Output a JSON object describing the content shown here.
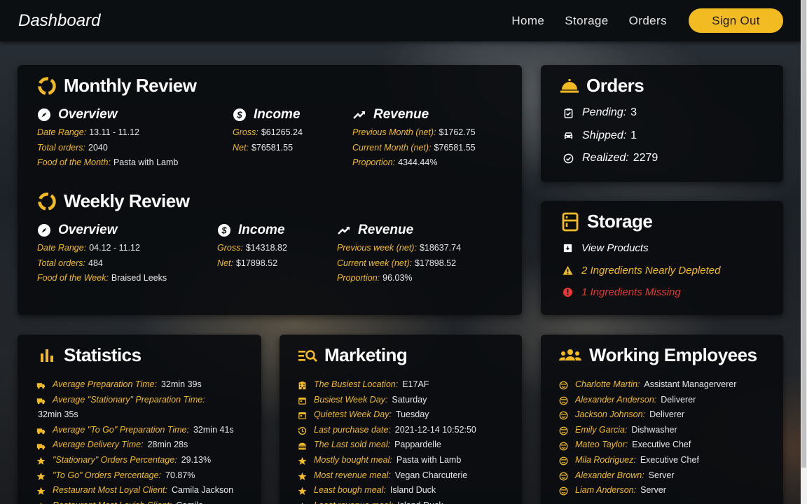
{
  "navbar": {
    "brand": "Dashboard",
    "links": [
      "Home",
      "Storage",
      "Orders"
    ],
    "signout": "Sign Out"
  },
  "colors": {
    "accent": "#f2bb21",
    "danger": "#e53935",
    "card_bg": "#0b0e11"
  },
  "monthly": {
    "title": "Monthly Review",
    "overview": {
      "title": "Overview",
      "rows": [
        {
          "k": "Date Range:",
          "v": "13.11 - 11.12"
        },
        {
          "k": "Total orders:",
          "v": "2040"
        },
        {
          "k": "Food of the Month:",
          "v": "Pasta with Lamb"
        }
      ]
    },
    "income": {
      "title": "Income",
      "rows": [
        {
          "k": "Gross:",
          "v": "$61265.24"
        },
        {
          "k": "Net:",
          "v": "$76581.55"
        }
      ]
    },
    "revenue": {
      "title": "Revenue",
      "rows": [
        {
          "k": "Previous Month (net):",
          "v": "$1762.75"
        },
        {
          "k": "Current Month (net):",
          "v": "$76581.55"
        },
        {
          "k": "Proportion:",
          "v": "4344.44%"
        }
      ]
    }
  },
  "weekly": {
    "title": "Weekly Review",
    "overview": {
      "title": "Overview",
      "rows": [
        {
          "k": "Date Range:",
          "v": "04.12 - 11.12"
        },
        {
          "k": "Total orders:",
          "v": "484"
        },
        {
          "k": "Food of the Week:",
          "v": "Braised Leeks"
        }
      ]
    },
    "income": {
      "title": "Income",
      "rows": [
        {
          "k": "Gross:",
          "v": "$14318.82"
        },
        {
          "k": "Net:",
          "v": "$17898.52"
        }
      ]
    },
    "revenue": {
      "title": "Revenue",
      "rows": [
        {
          "k": "Previous week (net):",
          "v": "$18637.74"
        },
        {
          "k": "Current week (net):",
          "v": "$17898.52"
        },
        {
          "k": "Proportion:",
          "v": "96.03%"
        }
      ]
    }
  },
  "orders": {
    "title": "Orders",
    "rows": [
      {
        "k": "Pending:",
        "v": "3"
      },
      {
        "k": "Shipped:",
        "v": "1"
      },
      {
        "k": "Realized:",
        "v": "2279"
      }
    ]
  },
  "storage": {
    "title": "Storage",
    "view_products": "View Products",
    "nearly_depleted": "2 Ingredients Nearly Depleted",
    "missing": "1 Ingredients Missing"
  },
  "statistics": {
    "title": "Statistics",
    "rows": [
      {
        "k": "Average Preparation Time:",
        "v": "32min 39s",
        "icon": "truck-icon"
      },
      {
        "k": "Average \"Stationary\" Preparation Time:",
        "v": "32min 35s",
        "icon": "truck-icon"
      },
      {
        "k": "Average \"To Go\" Preparation Time:",
        "v": "32min 41s",
        "icon": "truck-icon"
      },
      {
        "k": "Average Delivery Time:",
        "v": "28min 28s",
        "icon": "truck-icon"
      },
      {
        "k": "\"Stationary\" Orders Percentage:",
        "v": "29.13%",
        "icon": "star-icon"
      },
      {
        "k": "\"To Go\" Orders Percentage:",
        "v": "70.87%",
        "icon": "star-icon"
      },
      {
        "k": "Restaurant Most Loyal Client:",
        "v": "Camila Jackson",
        "icon": "star-icon"
      },
      {
        "k": "Restaurant Most Lavish Client:",
        "v": "Camila",
        "icon": "star-icon"
      }
    ]
  },
  "marketing": {
    "title": "Marketing",
    "rows": [
      {
        "k": "The Busiest Location:",
        "v": "E17AF",
        "icon": "building-icon"
      },
      {
        "k": "Busiest Week Day:",
        "v": "Saturday",
        "icon": "calendar-icon"
      },
      {
        "k": "Quietest Week Day:",
        "v": "Tuesday",
        "icon": "calendar-icon"
      },
      {
        "k": "Last purchase date:",
        "v": "2021-12-14 10:52:50",
        "icon": "history-icon"
      },
      {
        "k": "The Last sold meal:",
        "v": "Pappardelle",
        "icon": "burger-icon"
      },
      {
        "k": "Mostly bought meal:",
        "v": "Pasta with Lamb",
        "icon": "star-icon"
      },
      {
        "k": "Most revenue meal:",
        "v": "Vegan Charcuterie",
        "icon": "star-icon"
      },
      {
        "k": "Least bough meal:",
        "v": "Island Duck",
        "icon": "star-icon"
      },
      {
        "k": "Least revenue meal:",
        "v": "Island Duck",
        "icon": "star-icon"
      }
    ]
  },
  "employees": {
    "title": "Working Employees",
    "rows": [
      {
        "k": "Charlotte Martin:",
        "v": "Assistant Managerverer"
      },
      {
        "k": "Alexander Anderson:",
        "v": "Deliverer"
      },
      {
        "k": "Jackson Johnson:",
        "v": "Deliverer"
      },
      {
        "k": "Emily Garcia:",
        "v": "Dishwasher"
      },
      {
        "k": "Mateo Taylor:",
        "v": "Executive Chef"
      },
      {
        "k": "Mila Rodriguez:",
        "v": "Executive Chef"
      },
      {
        "k": "Alexander Brown:",
        "v": "Server"
      },
      {
        "k": "Liam Anderson:",
        "v": "Server"
      }
    ]
  }
}
